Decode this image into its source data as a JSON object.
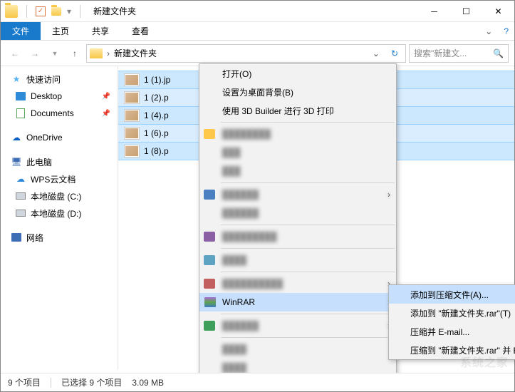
{
  "window": {
    "title": "新建文件夹",
    "qat_checked": "✓"
  },
  "ribbon": {
    "file": "文件",
    "home": "主页",
    "share": "共享",
    "view": "查看"
  },
  "address": {
    "path": "新建文件夹",
    "search_placeholder": "搜索\"新建文..."
  },
  "sidebar": {
    "quick": "快速访问",
    "desktop": "Desktop",
    "documents": "Documents",
    "onedrive": "OneDrive",
    "thispc": "此电脑",
    "wps": "WPS云文档",
    "diskc": "本地磁盘 (C:)",
    "diskd": "本地磁盘 (D:)",
    "network": "网络"
  },
  "files": [
    "1 (1).jp",
    "1 (2).p",
    "1 (4).p",
    "1 (6).p",
    "1 (8).p"
  ],
  "menu": {
    "open": "打开(O)",
    "setbg": "设置为桌面背景(B)",
    "print3d": "使用 3D Builder 进行 3D 打印",
    "winrar": "WinRAR"
  },
  "submenu": {
    "add": "添加到压缩文件(A)...",
    "addto": "添加到 \"新建文件夹.rar\"(T)",
    "email": "压缩并 E-mail...",
    "compressemail": "压缩到 \"新建文件夹.rar\" 并 E-m"
  },
  "status": {
    "items": "9 个项目",
    "selected": "已选择 9 个项目",
    "size": "3.09 MB"
  },
  "watermark": "系统之家"
}
